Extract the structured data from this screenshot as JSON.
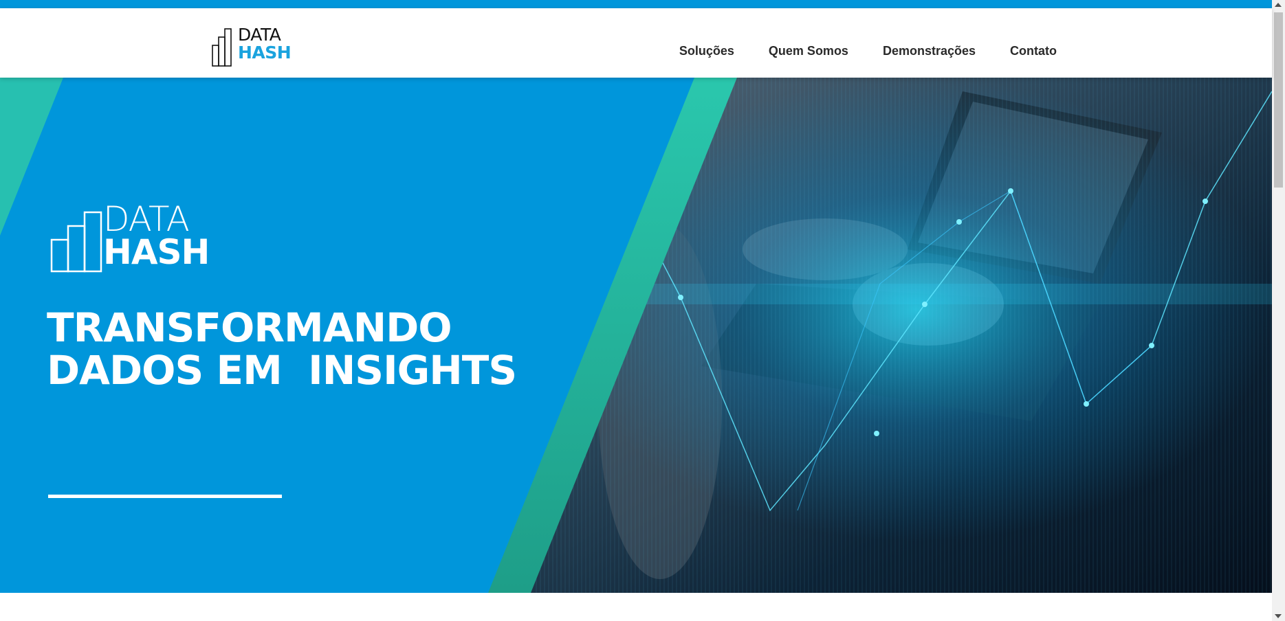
{
  "brand": {
    "logo_word_1": "DATA",
    "logo_word_2": "HASH",
    "primary_color": "#0096db",
    "accent_color": "#22c3a6",
    "logo_accent_color": "#1aa3de"
  },
  "nav": {
    "items": [
      {
        "label": "Soluções"
      },
      {
        "label": "Quem Somos"
      },
      {
        "label": "Demonstrações"
      },
      {
        "label": "Contato"
      }
    ]
  },
  "hero": {
    "headline_line_1": "TRANSFORMANDO",
    "headline_line_2": "DADOS EM  INSIGHTS",
    "image_icon": "data-analytics-photo"
  }
}
